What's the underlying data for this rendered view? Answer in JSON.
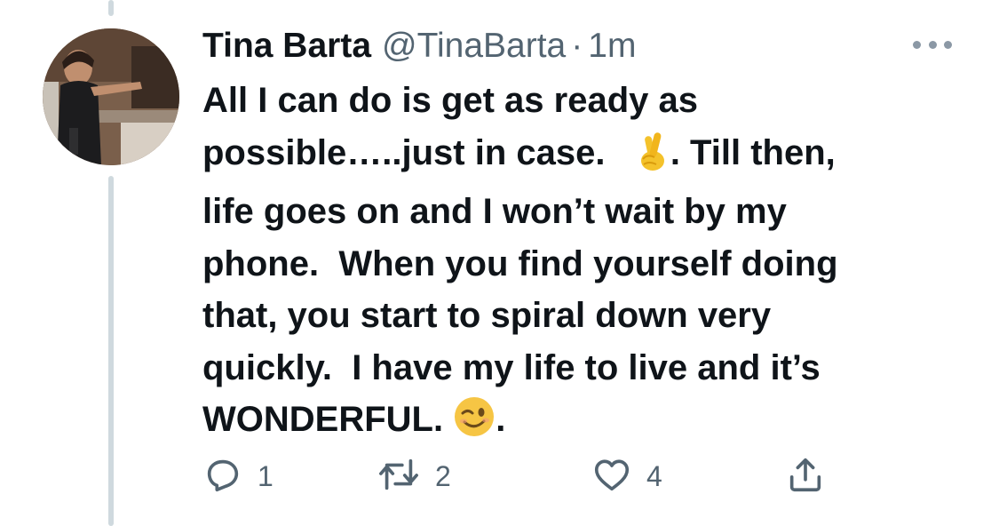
{
  "tweet": {
    "display_name": "Tina Barta",
    "handle": "@TinaBarta",
    "separator": "·",
    "timestamp": "1m",
    "text_part1": "All I can do is get as ready as\npossible…..just in case.   ",
    "emoji_1": "crossed-fingers",
    "text_part2": ". Till then,\nlife goes on and I won’t wait by my\nphone.  When you find yourself doing\nthat, you start to spiral down very\nquickly.  I have my life to live and it’s\nWONDERFUL. ",
    "emoji_2": "winking-face",
    "text_part3": "."
  },
  "actions": {
    "reply_count": "1",
    "retweet_count": "2",
    "like_count": "4"
  },
  "icons": {
    "more": "more-horizontal-icon",
    "reply": "reply-icon",
    "retweet": "retweet-icon",
    "like": "heart-icon",
    "share": "share-icon"
  },
  "colors": {
    "text": "#0f1419",
    "secondary": "#536471",
    "thread_line": "#cfd9de"
  }
}
